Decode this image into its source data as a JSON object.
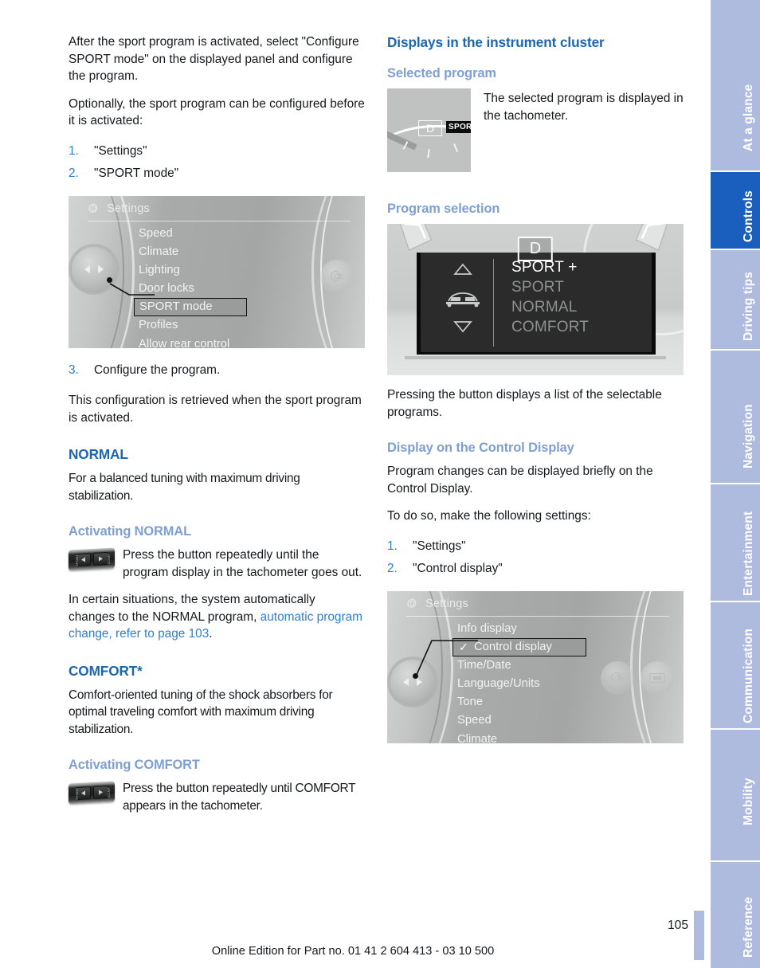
{
  "left_column": {
    "intro_paragraph": "After the sport program is activated, select \"Configure SPORT mode\" on the displayed panel and configure the program.",
    "optional_paragraph": "Optionally, the sport program can be configured before it is activated:",
    "steps": [
      {
        "num": "1.",
        "text": "\"Settings\""
      },
      {
        "num": "2.",
        "text": "\"SPORT mode\""
      }
    ],
    "settings_figure": {
      "header_title": "Settings",
      "header_icon": "gear-icon",
      "menu_items": [
        {
          "label": "Speed",
          "selected": false,
          "checked": false
        },
        {
          "label": "Climate",
          "selected": false,
          "checked": false
        },
        {
          "label": "Lighting",
          "selected": false,
          "checked": false
        },
        {
          "label": "Door locks",
          "selected": false,
          "checked": false
        },
        {
          "label": "SPORT mode",
          "selected": true,
          "checked": false
        },
        {
          "label": "Profiles",
          "selected": false,
          "checked": false
        },
        {
          "label": "Allow rear control",
          "selected": false,
          "checked": false
        }
      ],
      "controller_icon": "idrive-controller-knob",
      "side_button_icon": "gear-button-icon"
    },
    "step3": {
      "num": "3.",
      "text": "Configure the program."
    },
    "retrieved_paragraph": "This configuration is retrieved when the sport program is activated.",
    "normal_heading": "NORMAL",
    "normal_paragraph": "For a balanced tuning with maximum driving stabilization.",
    "activating_normal_heading": "Activating NORMAL",
    "activating_normal_text": "Press the button repeatedly until the program display in the tachometer goes out.",
    "auto_change_prefix": "In certain situations, the system automatically changes to the NORMAL program, ",
    "auto_change_link": "automatic program change, refer to page 103",
    "auto_change_suffix": ".",
    "comfort_heading": "COMFORT*",
    "comfort_paragraph": "Comfort-oriented tuning of the shock absorbers for optimal traveling comfort with maximum driving stabilization.",
    "activating_comfort_heading": "Activating COMFORT",
    "activating_comfort_text": "Press the button repeatedly until COMFORT appears in the tachometer.",
    "rocker_switch_icon": "rocker-switch-icon"
  },
  "right_column": {
    "main_heading": "Displays in the instrument cluster",
    "selected_program_heading": "Selected program",
    "tachometer_figure": {
      "gear_indicator": "D",
      "mode_badge": "SPORT"
    },
    "selected_program_text": "The selected program is displayed in the tachometer.",
    "program_selection_heading": "Program selection",
    "cluster_figure": {
      "gear_indicator": "D",
      "up_arrow_icon": "triangle-up-icon",
      "car_icon": "car-front-icon",
      "down_arrow_icon": "triangle-down-icon",
      "programs": [
        {
          "label": "SPORT +",
          "active": true
        },
        {
          "label": "SPORT",
          "active": false
        },
        {
          "label": "NORMAL",
          "active": false
        },
        {
          "label": "COMFORT",
          "active": false
        }
      ]
    },
    "pressing_button_text": "Pressing the button displays a list of the selectable programs.",
    "control_display_heading": "Display on the Control Display",
    "control_display_text": "Program changes can be displayed briefly on the Control Display.",
    "to_do_so_text": "To do so, make the following settings:",
    "steps": [
      {
        "num": "1.",
        "text": "\"Settings\""
      },
      {
        "num": "2.",
        "text": "\"Control display\""
      }
    ],
    "settings_figure": {
      "header_title": "Settings",
      "header_icon": "gear-icon",
      "menu_items": [
        {
          "label": "Info display",
          "selected": false,
          "checked": false
        },
        {
          "label": "Control display",
          "selected": true,
          "checked": true
        },
        {
          "label": "Time/Date",
          "selected": false,
          "checked": false
        },
        {
          "label": "Language/Units",
          "selected": false,
          "checked": false
        },
        {
          "label": "Tone",
          "selected": false,
          "checked": false
        },
        {
          "label": "Speed",
          "selected": false,
          "checked": false
        },
        {
          "label": "Climate",
          "selected": false,
          "checked": false
        }
      ],
      "controller_icon": "idrive-controller-knob",
      "side_button_icon_1": "gear-button-icon",
      "side_button_icon_2": "display-button-icon",
      "check_mark": "✓"
    }
  },
  "sidebar": {
    "tabs": [
      {
        "label": "At a glance",
        "active": false
      },
      {
        "label": "Controls",
        "active": true
      },
      {
        "label": "Driving tips",
        "active": false
      },
      {
        "label": "Navigation",
        "active": false
      },
      {
        "label": "Entertainment",
        "active": false
      },
      {
        "label": "Communication",
        "active": false
      },
      {
        "label": "Mobility",
        "active": false
      },
      {
        "label": "Reference",
        "active": false
      }
    ]
  },
  "footer": {
    "page_number": "105",
    "edition_text": "Online Edition for Part no. 01 41 2 604 413 - 03 10 500"
  },
  "colors": {
    "heading_blue": "#1a66b3",
    "subheading_blue": "#7f9fd2",
    "link_blue": "#2f7fd0",
    "tab_inactive": "#aebbdf",
    "tab_active": "#1a5fbd",
    "body_text": "#16191c"
  }
}
